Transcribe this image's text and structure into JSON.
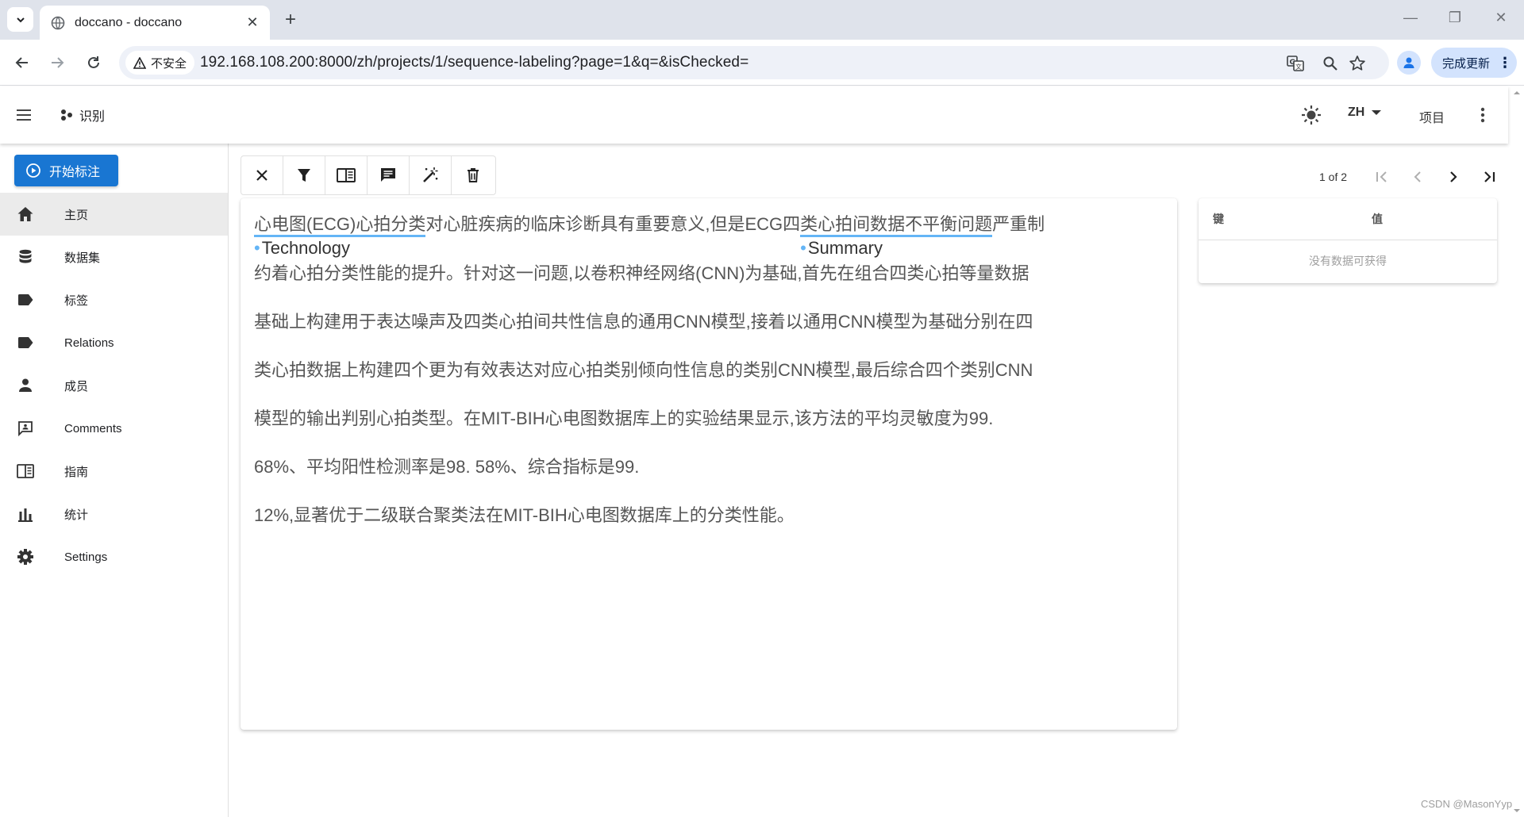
{
  "browser": {
    "tab_title": "doccano - doccano",
    "new_tab": "+",
    "security_chip": "不安全",
    "url": "192.168.108.200:8000/zh/projects/1/sequence-labeling?page=1&q=&isChecked=",
    "update_button": "完成更新"
  },
  "appbar": {
    "project_name": "识别",
    "language": "ZH",
    "projects_label": "项目"
  },
  "sidebar": {
    "start_button": "开始标注",
    "items": [
      {
        "label": "主页",
        "icon": "home-icon"
      },
      {
        "label": "数据集",
        "icon": "database-icon"
      },
      {
        "label": "标签",
        "icon": "label-icon"
      },
      {
        "label": "Relations",
        "icon": "relation-icon"
      },
      {
        "label": "成员",
        "icon": "person-icon"
      },
      {
        "label": "Comments",
        "icon": "comment-icon"
      },
      {
        "label": "指南",
        "icon": "book-icon"
      },
      {
        "label": "统计",
        "icon": "chart-icon"
      },
      {
        "label": "Settings",
        "icon": "gear-icon"
      }
    ]
  },
  "pager": {
    "text": "1 of 2"
  },
  "document": {
    "line1": {
      "entity1_text": "心电图(ECG)心拍分类",
      "entity1_label": "Technology",
      "mid_text": "对心脏疾病的临床诊断具有重要意义,但是ECG四",
      "entity2_text": "类心拍间数据不平衡问题",
      "entity2_label": "Summary",
      "tail_text": "严重制"
    },
    "lines": [
      "约着心拍分类性能的提升。针对这一问题,以卷积神经网络(CNN)为基础,首先在组合四类心拍等量数据",
      "基础上构建用于表达噪声及四类心拍间共性信息的通用CNN模型,接着以通用CNN模型为基础分别在四",
      "类心拍数据上构建四个更为有效表达对应心拍类别倾向性信息的类别CNN模型,最后综合四个类别CNN",
      "模型的输出判别心拍类型。在MIT-BIH心电图数据库上的实验结果显示,该方法的平均灵敏度为99.",
      "68%、平均阳性检测率是98. 58%、综合指标是99.",
      "12%,显著优于二级联合聚类法在MIT-BIH心电图数据库上的分类性能。"
    ]
  },
  "metadata": {
    "key_header": "键",
    "value_header": "值",
    "empty_text": "没有数据可获得"
  },
  "watermark": "CSDN @MasonYyp",
  "colors": {
    "primary": "#1976d2",
    "entity_underline": "#64b5f6"
  }
}
